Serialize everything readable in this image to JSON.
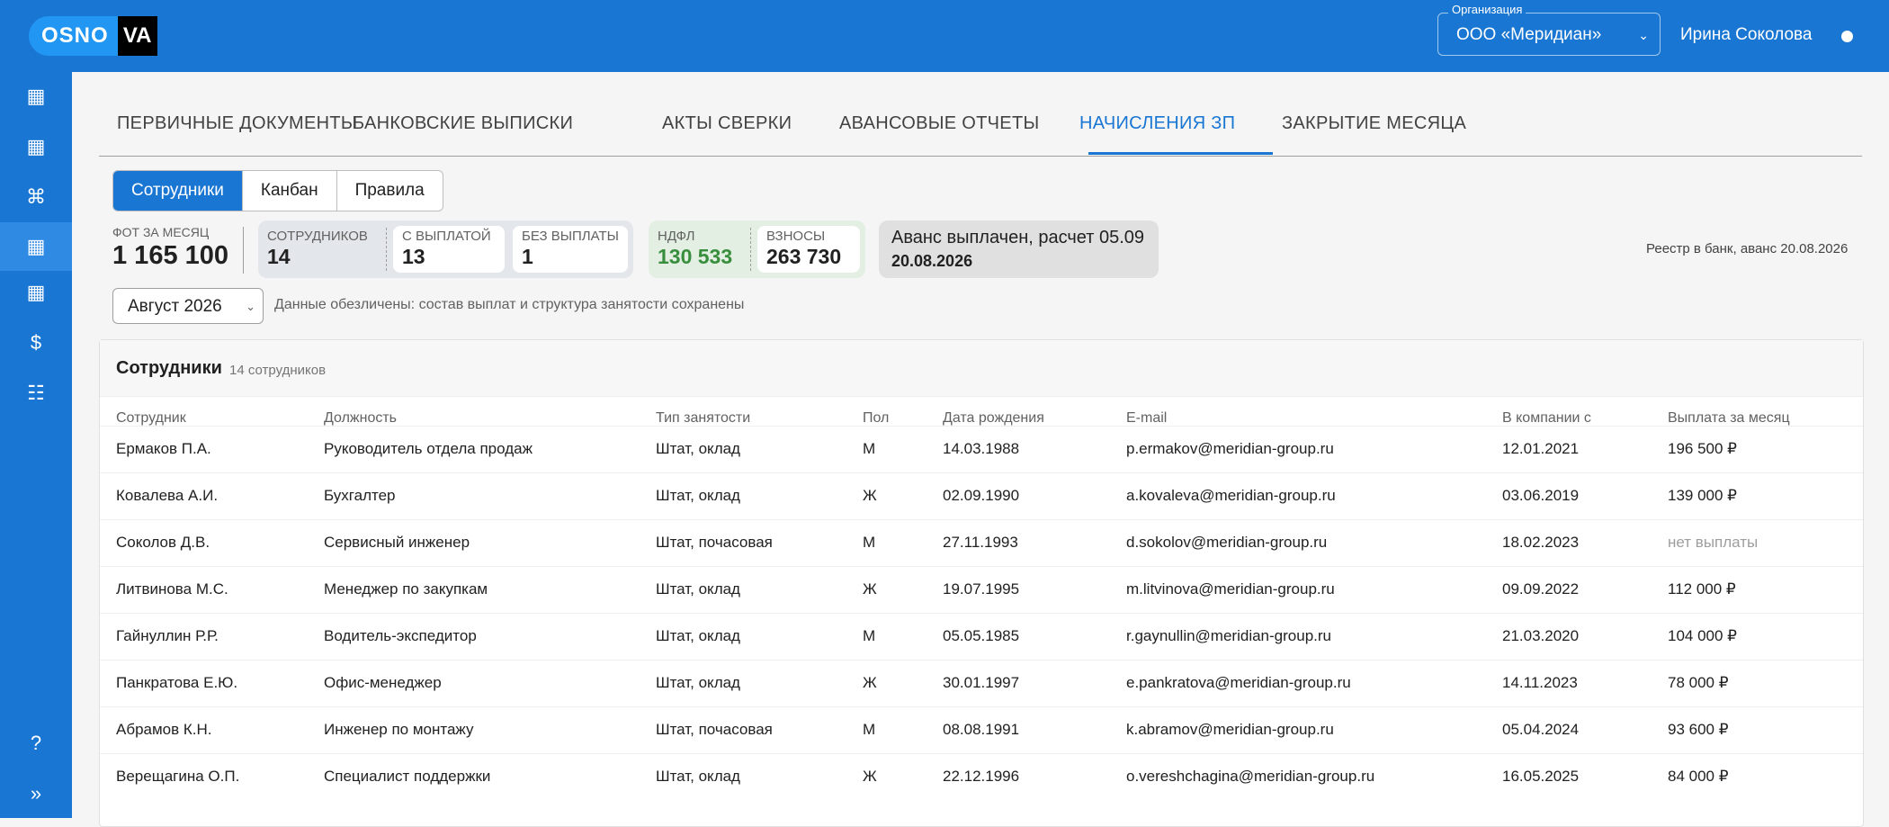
{
  "header": {
    "logo_left": "OSNO",
    "logo_right": "VA",
    "org_label": "Организация",
    "org_value": "ООО «Меридиан»",
    "user_name": "Ирина Соколова"
  },
  "sidebar": {
    "items": [
      {
        "icon": "table-icon",
        "glyph": "▦"
      },
      {
        "icon": "table-icon",
        "glyph": "▦"
      },
      {
        "icon": "command-icon",
        "glyph": "⌘"
      },
      {
        "icon": "table-icon",
        "glyph": "▦"
      },
      {
        "icon": "table-icon",
        "glyph": "▦"
      },
      {
        "icon": "dollar-icon",
        "glyph": "$"
      },
      {
        "icon": "list-icon",
        "glyph": "☷"
      }
    ],
    "help": "?",
    "expand": "»"
  },
  "tabs": [
    "ПЕРВИЧНЫЕ ДОКУМЕНТЫ",
    "БАНКОВСКИЕ ВЫПИСКИ",
    "АКТЫ СВЕРКИ",
    "АВАНСОВЫЕ ОТЧЕТЫ",
    "НАЧИСЛЕНИЯ ЗП",
    "ЗАКРЫТИЕ МЕСЯЦА"
  ],
  "views": [
    "Сотрудники",
    "Канбан",
    "Правила"
  ],
  "stats": {
    "fot_label": "ФОТ ЗА МЕСЯЦ",
    "fot_value": "1 165 100",
    "employees_label": "СОТРУДНИКОВ",
    "employees_value": "14",
    "paid_label": "С ВЫПЛАТОЙ",
    "paid_value": "13",
    "unpaid_label": "БЕЗ ВЫПЛАТЫ",
    "unpaid_value": "1",
    "ndfl_label": "НДФЛ",
    "ndfl_value": "130 533",
    "contrib_label": "ВЗНОСЫ",
    "contrib_value": "263 730",
    "advance_text": "Аванс выплачен, расчет 05.09",
    "advance_date": "20.08.2026",
    "registry": "Реестр в банк, аванс 20.08.2026"
  },
  "filter": {
    "month": "Август 2026",
    "note": "Данные обезличены: состав выплат и структура занятости сохранены"
  },
  "table": {
    "title": "Сотрудники",
    "count": "14 сотрудников",
    "columns": [
      "Сотрудник",
      "Должность",
      "Тип занятости",
      "Пол",
      "Дата рождения",
      "E-mail",
      "В компании с",
      "Выплата за месяц"
    ],
    "rows": [
      [
        "Ермаков П.А.",
        "Руководитель отдела продаж",
        "Штат, оклад",
        "М",
        "14.03.1988",
        "p.ermakov@meridian-group.ru",
        "12.01.2021",
        "196 500 ₽"
      ],
      [
        "Ковалева А.И.",
        "Бухгалтер",
        "Штат, оклад",
        "Ж",
        "02.09.1990",
        "a.kovaleva@meridian-group.ru",
        "03.06.2019",
        "139 000 ₽"
      ],
      [
        "Соколов Д.В.",
        "Сервисный инженер",
        "Штат, почасовая",
        "М",
        "27.11.1993",
        "d.sokolov@meridian-group.ru",
        "18.02.2023",
        "нет выплаты"
      ],
      [
        "Литвинова М.С.",
        "Менеджер по закупкам",
        "Штат, оклад",
        "Ж",
        "19.07.1995",
        "m.litvinova@meridian-group.ru",
        "09.09.2022",
        "112 000 ₽"
      ],
      [
        "Гайнуллин Р.Р.",
        "Водитель-экспедитор",
        "Штат, оклад",
        "М",
        "05.05.1985",
        "r.gaynullin@meridian-group.ru",
        "21.03.2020",
        "104 000 ₽"
      ],
      [
        "Панкратова Е.Ю.",
        "Офис-менеджер",
        "Штат, оклад",
        "Ж",
        "30.01.1997",
        "e.pankratova@meridian-group.ru",
        "14.11.2023",
        "78 000 ₽"
      ],
      [
        "Абрамов К.Н.",
        "Инженер по монтажу",
        "Штат, почасовая",
        "М",
        "08.08.1991",
        "k.abramov@meridian-group.ru",
        "05.04.2024",
        "93 600 ₽"
      ],
      [
        "Верещагина О.П.",
        "Специалист поддержки",
        "Штат, оклад",
        "Ж",
        "22.12.1996",
        "o.vereshchagina@meridian-group.ru",
        "16.05.2025",
        "84 000 ₽"
      ]
    ]
  }
}
